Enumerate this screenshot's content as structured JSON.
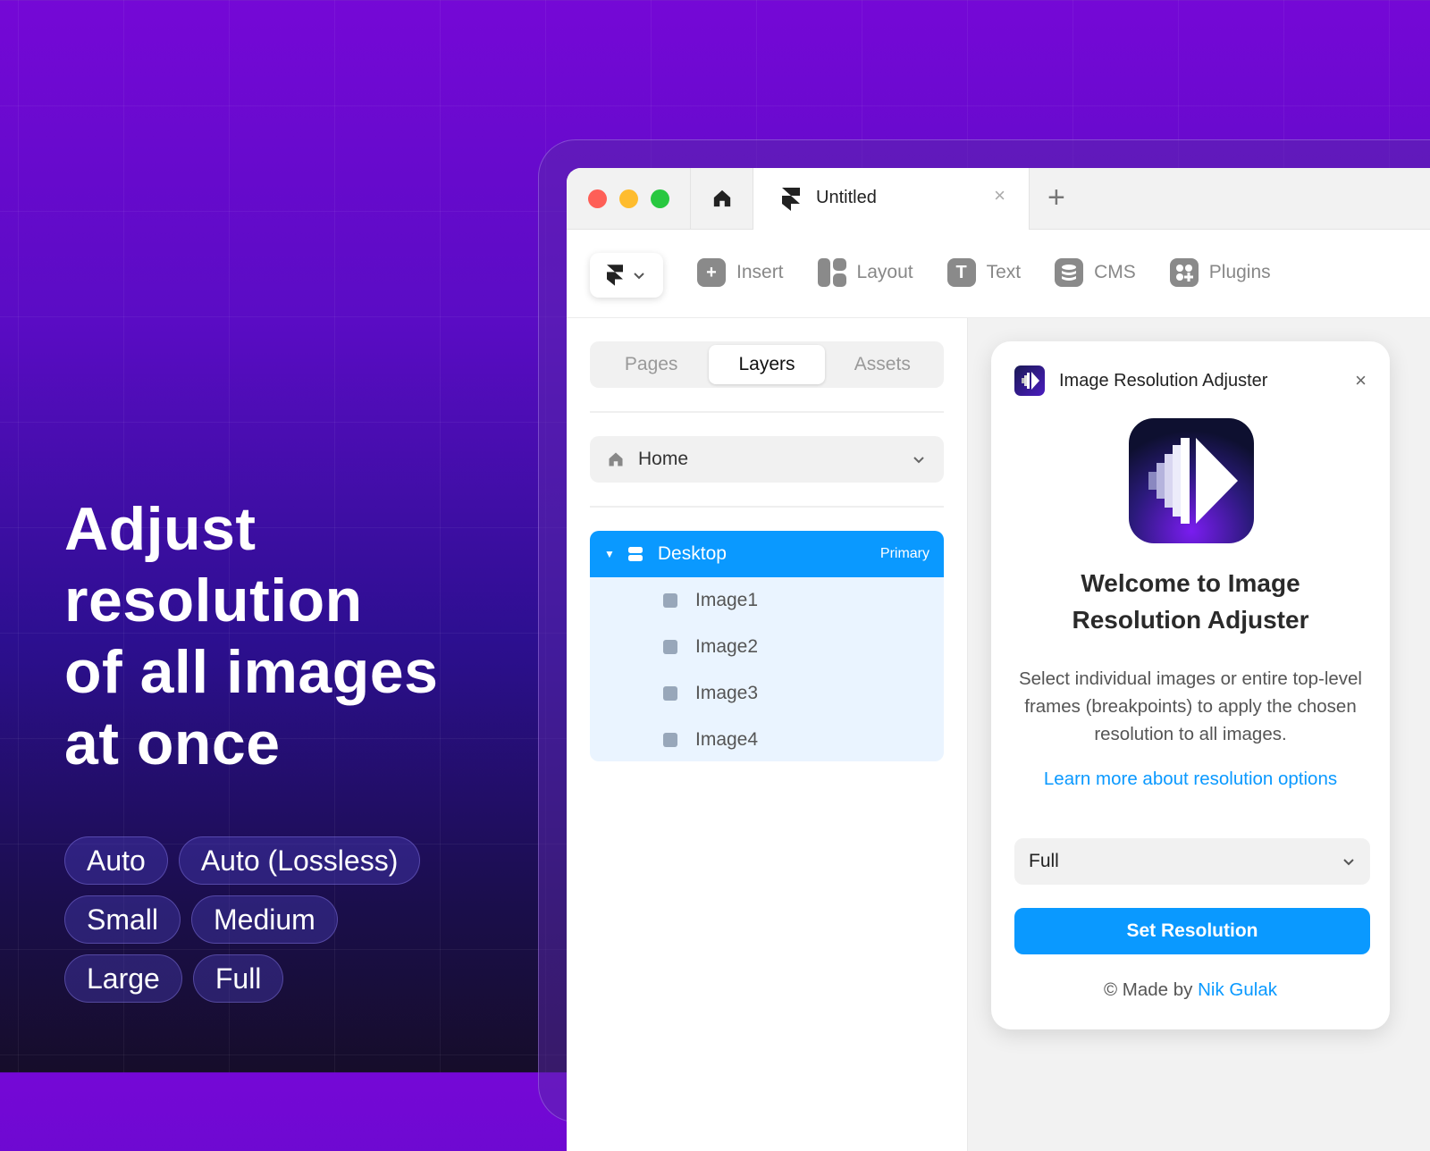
{
  "headline": "Adjust\nresolution\nof all images\nat once",
  "chips": [
    [
      "Auto",
      "Auto (Lossless)"
    ],
    [
      "Small",
      "Medium"
    ],
    [
      "Large",
      "Full"
    ]
  ],
  "browser": {
    "tab_title": "Untitled",
    "tab_close": "×",
    "new_tab": "+"
  },
  "toolbar": {
    "insert": "Insert",
    "layout": "Layout",
    "text": "Text",
    "cms": "CMS",
    "plugins": "Plugins"
  },
  "left_panel": {
    "tabs": [
      "Pages",
      "Layers",
      "Assets"
    ],
    "active_tab": "Layers",
    "page": "Home",
    "layers": {
      "frame": "Desktop",
      "badge": "Primary",
      "children": [
        "Image1",
        "Image2",
        "Image3",
        "Image4"
      ]
    }
  },
  "plugin": {
    "title": "Image Resolution Adjuster",
    "close": "×",
    "welcome_line1": "Welcome to Image",
    "welcome_line2": "Resolution Adjuster",
    "description": "Select individual images or entire top-level frames (breakpoints) to apply the chosen resolution to all images.",
    "learn_more": "Learn more about resolution options",
    "resolution_value": "Full",
    "set_button": "Set Resolution",
    "made_prefix": "© Made by ",
    "author": "Nik Gulak"
  },
  "colors": {
    "accent": "#0a99ff",
    "close_red": "#fe5f57",
    "min_yellow": "#febc2e",
    "max_green": "#28c840"
  }
}
